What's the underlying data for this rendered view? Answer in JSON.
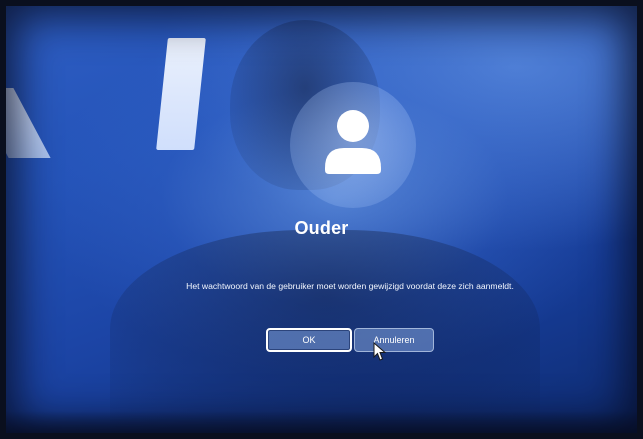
{
  "dialog": {
    "user_name": "Ouder",
    "message": "Het wachtwoord van de gebruiker moet worden gewijzigd voordat deze zich aanmeldt.",
    "ok_label": "OK",
    "cancel_label": "Annuleren"
  },
  "icons": {
    "avatar": "user-avatar-icon",
    "pointer": "mouse-pointer-icon"
  },
  "colors": {
    "background": "#2453b8",
    "button_fill": "#9ab9f0",
    "text": "#ffffff"
  }
}
